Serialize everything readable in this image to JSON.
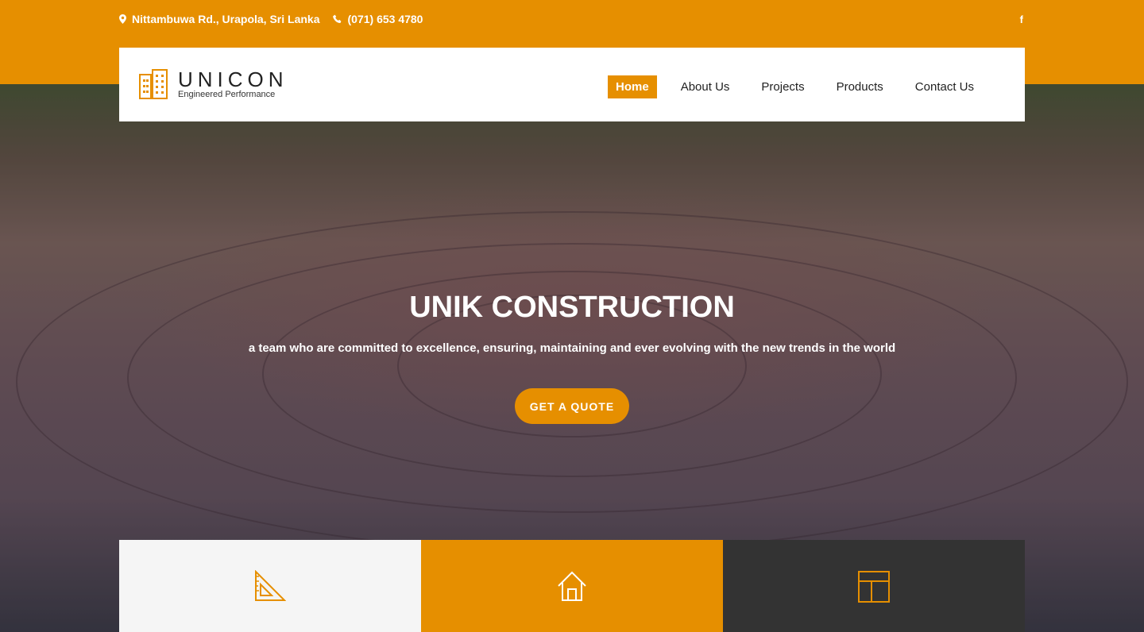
{
  "topbar": {
    "address": "Nittambuwa Rd., Urapola, Sri Lanka",
    "phone": "(071) 653 4780",
    "social": "f",
    "address_icon": "map-pin-icon",
    "phone_icon": "phone-icon",
    "color": "#e68f00"
  },
  "logo": {
    "name": "UNICON",
    "tagline": "Engineered Performance",
    "icon": "building-icon"
  },
  "nav": {
    "items": [
      {
        "label": "Home",
        "active": true
      },
      {
        "label": "About Us",
        "active": false
      },
      {
        "label": "Projects",
        "active": false
      },
      {
        "label": "Products",
        "active": false
      },
      {
        "label": "Contact Us",
        "active": false
      }
    ]
  },
  "hero": {
    "title": "UNIK CONSTRUCTION",
    "subtitle": "a team who are committed to excellence, ensuring, maintaining and ever evolving with the new trends in the world",
    "cta": "GET A QUOTE"
  },
  "features": [
    {
      "icon": "set-square-icon",
      "bg": "#f5f5f5"
    },
    {
      "icon": "home-icon",
      "bg": "#e68f00"
    },
    {
      "icon": "layout-icon",
      "bg": "#333333"
    }
  ],
  "colors": {
    "accent": "#e68f00",
    "dark": "#333333",
    "light": "#f5f5f5"
  }
}
